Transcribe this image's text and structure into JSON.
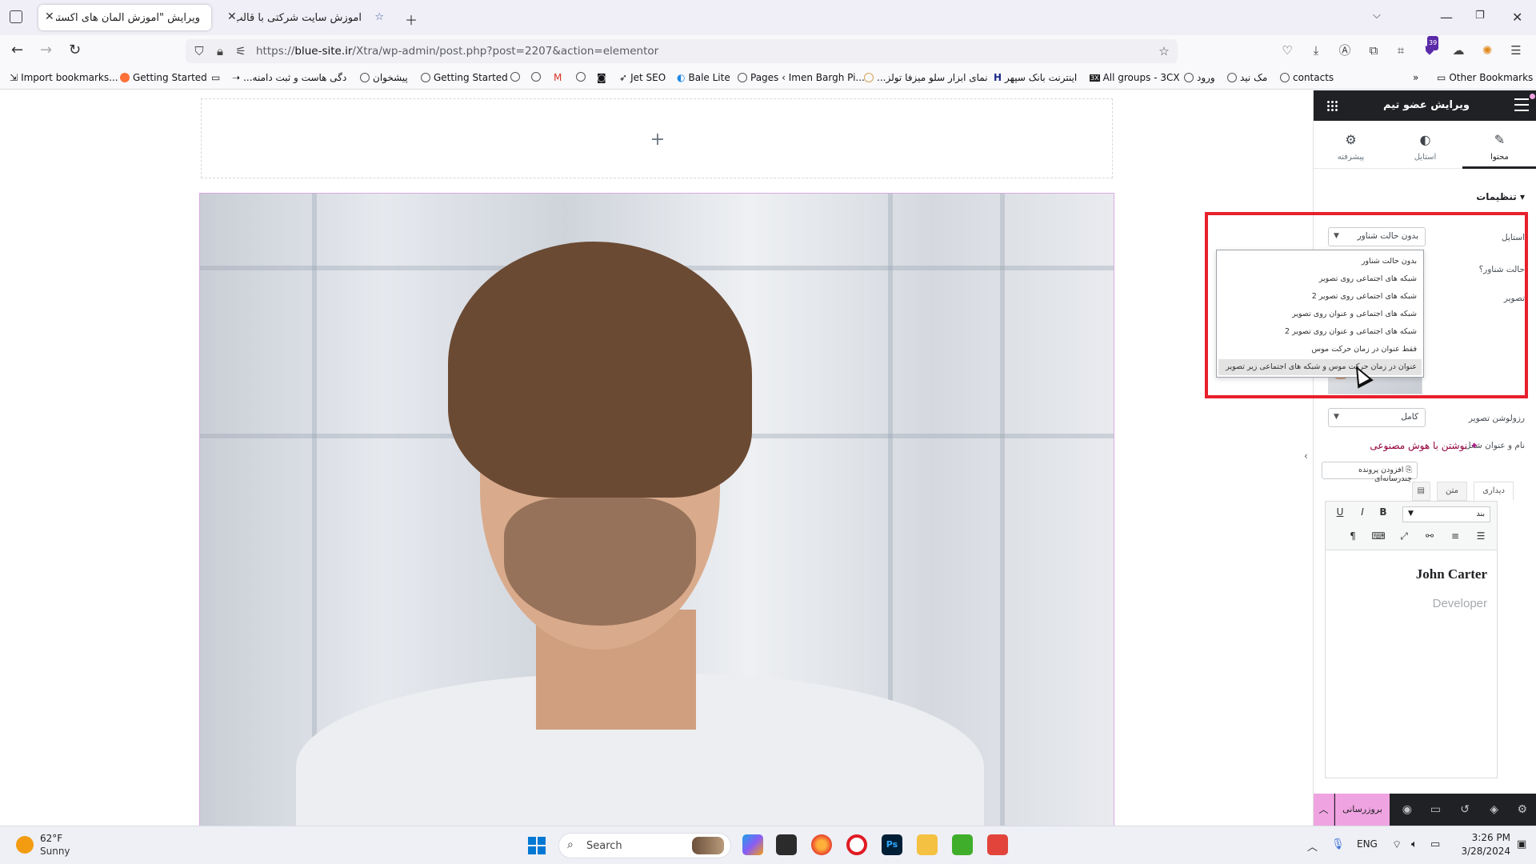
{
  "browser": {
    "tabs": [
      {
        "title": "ویرایش \"آموزش المان های اکسترا - ه",
        "active": true
      },
      {
        "title": "آموزش سایت شرکتی با قالب اکس",
        "active": false
      }
    ],
    "url_prefix": "https://",
    "url_domain": "blue-site.ir",
    "url_path": "/Xtra/wp-admin/post.php?post=2207&action=elementor",
    "extension_badge": "39",
    "bookmarks": [
      "Import bookmarks...",
      "Getting Started",
      "...دگی هاست و ثبت دامنه",
      "پیشخوان",
      "Getting Started",
      "Jet SEO",
      "Bale Lite",
      "Pages ‹ Imen Bargh Pi...",
      "...نمای ابزار سلو میزفا تولز",
      "اینترنت بانک سپهر",
      "All groups - 3CX",
      "ورود",
      "مک نید",
      "contacts"
    ],
    "other_bookmarks": "Other Bookmarks"
  },
  "canvas": {
    "add_section": "+"
  },
  "panel": {
    "title": "ویرایش عضو تیم",
    "tabs": [
      {
        "label": "محتوا",
        "icon": "pencil-icon",
        "active": true
      },
      {
        "label": "استایل",
        "icon": "half-circle-icon",
        "active": false
      },
      {
        "label": "پیشرفته",
        "icon": "gear-icon",
        "active": false
      }
    ],
    "section_title": "▾ تنظیمات",
    "style_label": "استایل",
    "style_value": "بدون حالت شناور",
    "hover_label": "حالت شناور؟",
    "image_label": "تصویر",
    "resolution_label": "رزولوشن تصویر",
    "resolution_value": "کامل",
    "name_label": "نام و عنوان شغل",
    "ai_link": "نوشتن با هوش مصنوعی",
    "media_button": "افزودن پرونده چندرسانه‌ای",
    "editor_tabs": [
      "دیداری",
      "متن"
    ],
    "format_value": "بند",
    "member_name": "John Carter",
    "member_role": "Developer",
    "update_button": "بروزرسانی"
  },
  "dropdown": {
    "options": [
      "بدون حالت شناور",
      "شبکه های اجتماعی روی تصویر",
      "شبکه های اجتماعی روی تصویر 2",
      "شبکه های اجتماعی و عنوان روی تصویر",
      "شبکه های اجتماعی و عنوان روی تصویر 2",
      "فقط عنوان در زمان حرکت موس",
      "عنوان در زمان حرکت موس و شبکه های اجتماعی زیر تصویر"
    ],
    "highlighted_index": 6
  },
  "taskbar": {
    "weather_temp": "62°F",
    "weather_condition": "Sunny",
    "search_placeholder": "Search",
    "language": "ENG",
    "time": "3:26 PM",
    "date": "3/28/2024"
  },
  "colors": {
    "accent_pink": "#f0a3e1",
    "panel_dark": "#1f2124",
    "highlight_red": "#e8202d",
    "ai_link": "#92003b"
  }
}
